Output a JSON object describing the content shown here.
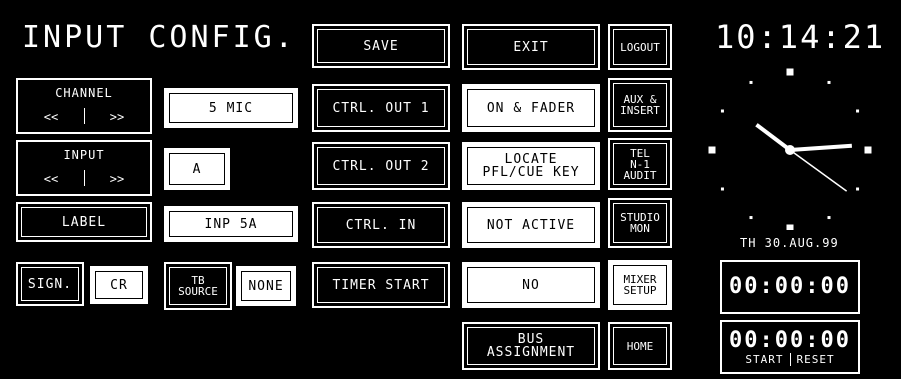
{
  "title": "INPUT CONFIG.",
  "clock": {
    "time": "10:14:21",
    "date": "TH 30.AUG.99",
    "hour": 10,
    "minute": 14,
    "second": 21
  },
  "timers": [
    {
      "value": "00:00:00"
    },
    {
      "value": "00:00:00",
      "start": "START",
      "reset": "RESET"
    }
  ],
  "left": {
    "channel": {
      "label": "CHANNEL",
      "prev": "<<",
      "next": ">>",
      "value": "5 MIC"
    },
    "input": {
      "label": "INPUT",
      "prev": "<<",
      "next": ">>",
      "value": "A"
    },
    "label_button": "LABEL",
    "label_value": "INP 5A",
    "sign": "SIGN.",
    "sign_value": "CR",
    "tb_source_1": "TB",
    "tb_source_2": "SOURCE",
    "tb_value": "NONE"
  },
  "col3": {
    "save": "SAVE",
    "ctrl_out_1": "CTRL. OUT 1",
    "ctrl_out_2": "CTRL. OUT 2",
    "ctrl_in": "CTRL. IN",
    "timer_start": "TIMER START"
  },
  "col4": {
    "exit": "EXIT",
    "on_fader": "ON & FADER",
    "locate_1": "LOCATE",
    "locate_2": "PFL/CUE KEY",
    "not_active": "NOT ACTIVE",
    "no": "NO",
    "bus_1": "BUS",
    "bus_2": "ASSIGNMENT"
  },
  "col5": {
    "logout": "LOGOUT",
    "aux_1": "AUX &",
    "aux_2": "INSERT",
    "tel_1": "TEL",
    "tel_2": "N-1",
    "tel_3": "AUDIT",
    "studio_1": "STUDIO",
    "studio_2": "MON",
    "mixer_1": "MIXER",
    "mixer_2": "SETUP",
    "home": "HOME"
  }
}
